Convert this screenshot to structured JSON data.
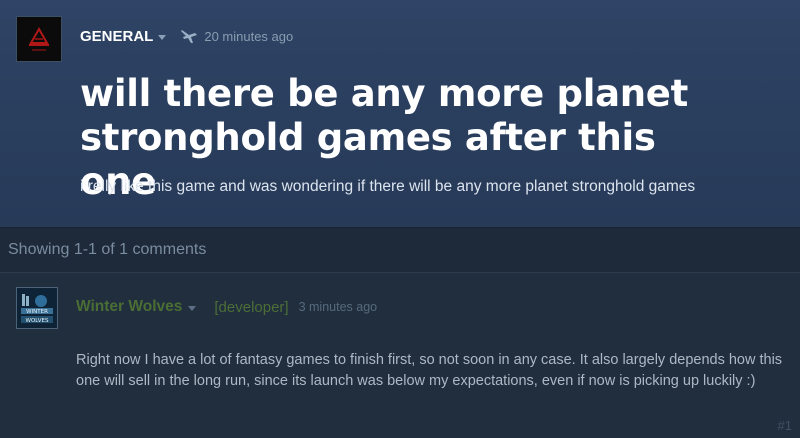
{
  "topic": {
    "author": "GENERAL",
    "timestamp": "20 minutes ago",
    "title": "will there be any more planet stronghold games after this one",
    "body": "i relly like this game and was wondering if there will be any more planet stronghold games"
  },
  "comments_summary": "Showing 1-1 of 1 comments",
  "comments": [
    {
      "author": "Winter Wolves",
      "role": "[developer]",
      "timestamp": "3 minutes ago",
      "text": "Right now I have a lot of fantasy games to finish first, so not soon in any case. It also largely depends how this one will sell in the long run, since its launch was below my expectations, even if now is picking up luckily :)",
      "number": "#1"
    }
  ],
  "colors": {
    "topic_bg": "#2f4466",
    "page_bg": "#1b2838",
    "developer_name": "#4a6e34"
  },
  "icons": {
    "op_avatar": "red-logo-avatar",
    "posted_via": "airplane-icon",
    "commenter_avatar": "winter-wolves-logo-avatar"
  }
}
